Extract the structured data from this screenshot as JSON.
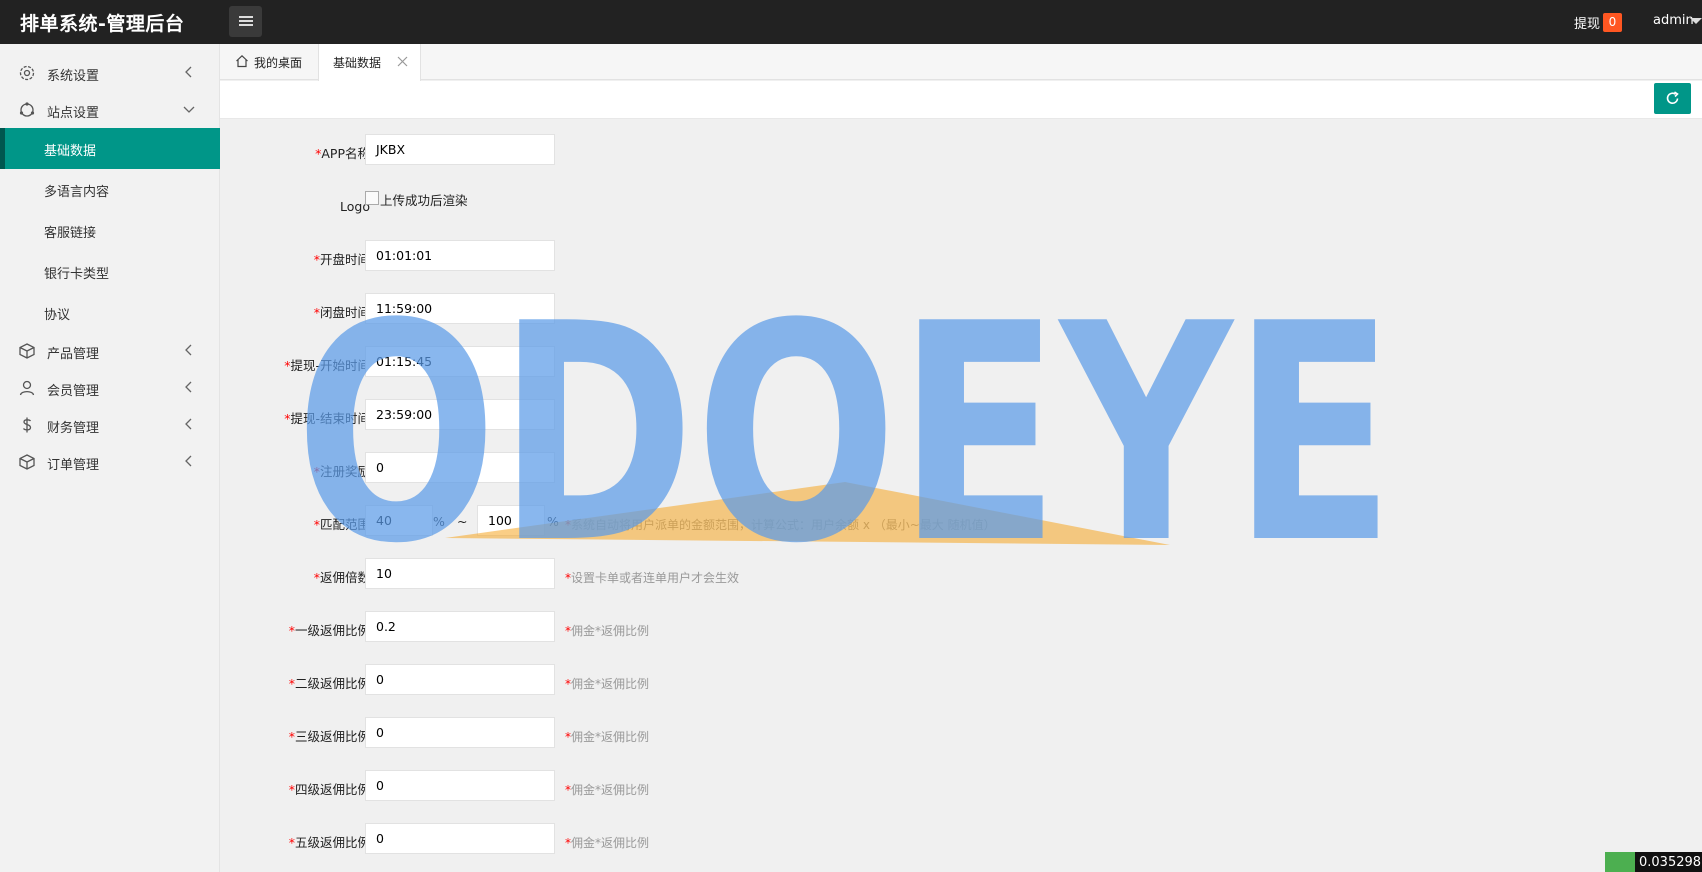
{
  "header": {
    "title": "排单系统-管理后台",
    "withdraw_label": "提现",
    "withdraw_count": "0",
    "user": "admin"
  },
  "sidebar": {
    "items": [
      {
        "label": "系统设置",
        "icon": "gear-icon",
        "state": "collapsed"
      },
      {
        "label": "站点设置",
        "icon": "site-icon",
        "state": "expanded",
        "children": [
          "基础数据",
          "多语言内容",
          "客服链接",
          "银行卡类型",
          "协议"
        ]
      },
      {
        "label": "产品管理",
        "icon": "box-icon",
        "state": "collapsed"
      },
      {
        "label": "会员管理",
        "icon": "user-icon",
        "state": "collapsed"
      },
      {
        "label": "财务管理",
        "icon": "dollar-icon",
        "state": "collapsed"
      },
      {
        "label": "订单管理",
        "icon": "box-icon",
        "state": "collapsed"
      }
    ],
    "active_child": "基础数据"
  },
  "tabs": [
    {
      "label": "我的桌面",
      "icon": "home-icon"
    },
    {
      "label": "基础数据",
      "closable": true,
      "active": true
    }
  ],
  "form": {
    "app_name": {
      "label": "APP名称",
      "value": "JKBX"
    },
    "logo": {
      "label": "Logo",
      "alt": "上传成功后渲染"
    },
    "open_time": {
      "label": "开盘时间",
      "value": "01:01:01"
    },
    "close_time": {
      "label": "闭盘时间",
      "value": "11:59:00"
    },
    "withdraw_start": {
      "label": "提现-开始时间",
      "value": "01:15:45"
    },
    "withdraw_end": {
      "label": "提现-结束时间",
      "value": "23:59:00"
    },
    "register_bonus": {
      "label": "注册奖励",
      "value": "0"
    },
    "match_range": {
      "label": "匹配范围",
      "min": "40",
      "max": "100",
      "unit": "%",
      "sep": "~",
      "hint": "系统自动将用户派单的金额范围，计算公式：用户余额 x （最小~最大 随机值）"
    },
    "commission_multiple": {
      "label": "返佣倍数",
      "value": "10",
      "hint": "设置卡单或者连单用户才会生效"
    },
    "level1": {
      "label": "一级返佣比例",
      "value": "0.2",
      "hint": "佣金*返佣比例"
    },
    "level2": {
      "label": "二级返佣比例",
      "value": "0",
      "hint": "佣金*返佣比例"
    },
    "level3": {
      "label": "三级返佣比例",
      "value": "0",
      "hint": "佣金*返佣比例"
    },
    "level4": {
      "label": "四级返佣比例",
      "value": "0",
      "hint": "佣金*返佣比例"
    },
    "level5": {
      "label": "五级返佣比例",
      "value": "0",
      "hint": "佣金*返佣比例"
    }
  },
  "required_mark": "*",
  "watermark": "ODOEYE",
  "corner_widget": {
    "text": "0.035298"
  },
  "colors": {
    "accent": "#009688",
    "header": "#222222",
    "badge": "#ff5722",
    "required": "#ff0000"
  }
}
